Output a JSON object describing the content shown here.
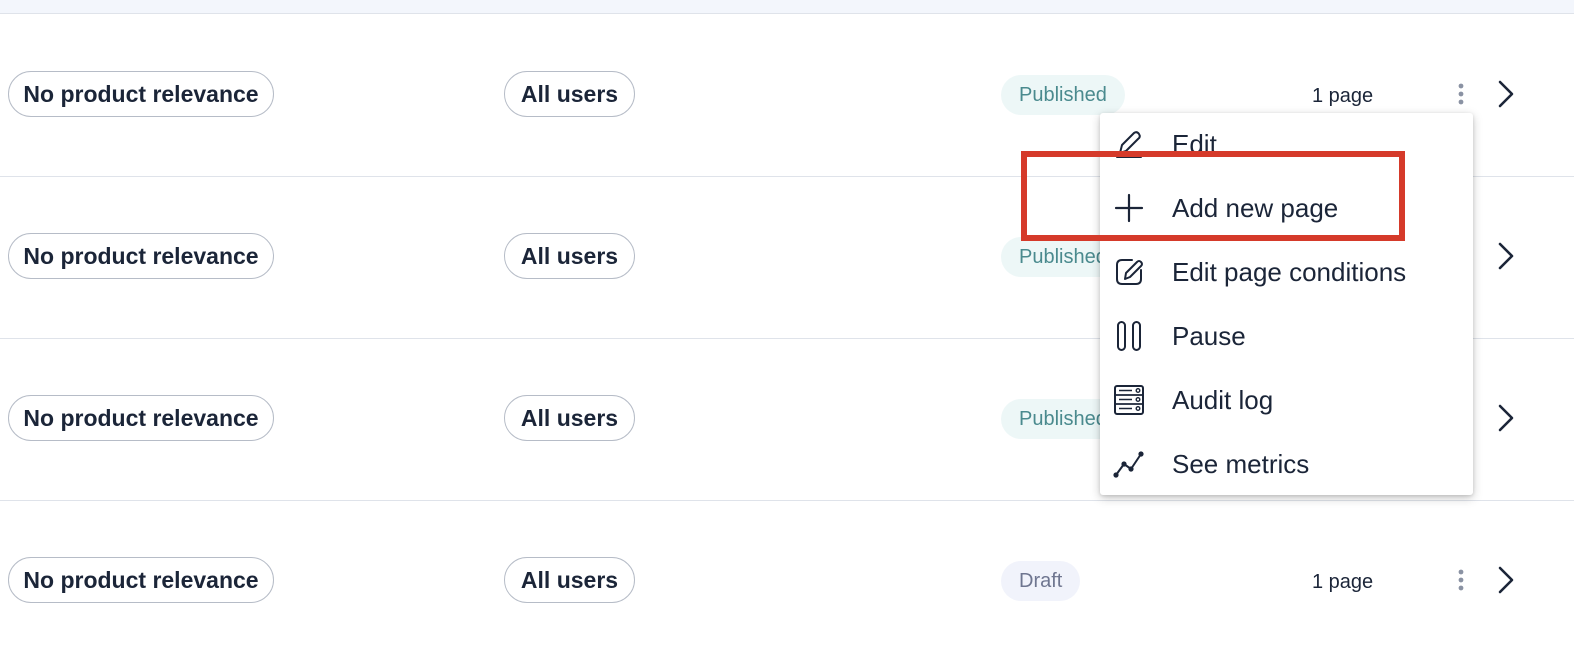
{
  "rows": [
    {
      "product": "No product relevance",
      "audience": "All users",
      "status": "Published",
      "pages": "1 page"
    },
    {
      "product": "No product relevance",
      "audience": "All users",
      "status": "Published",
      "pages": ""
    },
    {
      "product": "No product relevance",
      "audience": "All users",
      "status": "Published",
      "pages": ""
    },
    {
      "product": "No product relevance",
      "audience": "All users",
      "status": "Draft",
      "pages": "1 page"
    }
  ],
  "menu": {
    "items": [
      {
        "label": "Edit",
        "icon": "pencil-icon"
      },
      {
        "label": "Add new page",
        "icon": "plus-icon"
      },
      {
        "label": "Edit page conditions",
        "icon": "edit-square-icon"
      },
      {
        "label": "Pause",
        "icon": "pause-icon"
      },
      {
        "label": "Audit log",
        "icon": "audit-log-icon"
      },
      {
        "label": "See metrics",
        "icon": "metrics-icon"
      }
    ],
    "highlighted_item": "Add new page"
  },
  "colors": {
    "text": "#1b2538",
    "published_bg": "#edf7f7",
    "published_text": "#4a8a8e",
    "draft_bg": "#f1f3fb",
    "draft_text": "#6f7690",
    "highlight": "#d53a2a",
    "divider": "#dfe3ea"
  }
}
